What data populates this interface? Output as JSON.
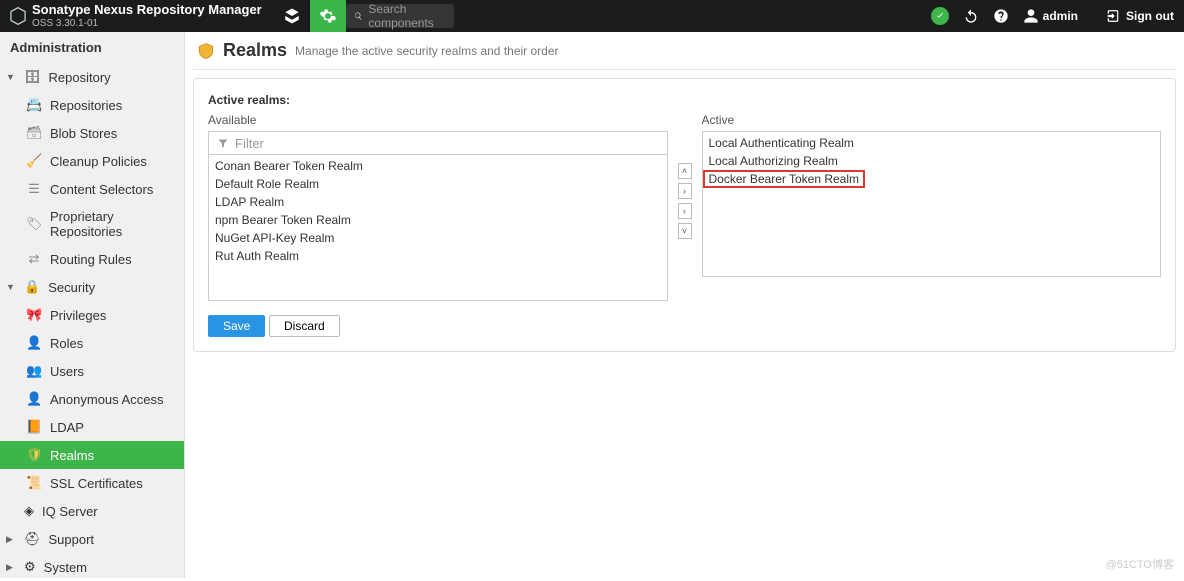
{
  "app": {
    "title": "Sonatype Nexus Repository Manager",
    "version": "OSS 3.30.1-01"
  },
  "search": {
    "placeholder": "Search components"
  },
  "header": {
    "username": "admin",
    "signout": "Sign out"
  },
  "sidebar": {
    "title": "Administration",
    "sections": [
      {
        "label": "Repository",
        "items": [
          {
            "label": "Repositories",
            "icon": "repos"
          },
          {
            "label": "Blob Stores",
            "icon": "blob"
          },
          {
            "label": "Cleanup Policies",
            "icon": "broom"
          },
          {
            "label": "Content Selectors",
            "icon": "stack"
          },
          {
            "label": "Proprietary Repositories",
            "icon": "prop"
          },
          {
            "label": "Routing Rules",
            "icon": "route"
          }
        ]
      },
      {
        "label": "Security",
        "items": [
          {
            "label": "Privileges",
            "icon": "ribbon"
          },
          {
            "label": "Roles",
            "icon": "person"
          },
          {
            "label": "Users",
            "icon": "people"
          },
          {
            "label": "Anonymous Access",
            "icon": "anon"
          },
          {
            "label": "LDAP",
            "icon": "book"
          },
          {
            "label": "Realms",
            "icon": "shield",
            "active": true
          },
          {
            "label": "SSL Certificates",
            "icon": "cert"
          }
        ]
      },
      {
        "label": "IQ Server",
        "collapsed": false,
        "noCaret": true
      },
      {
        "label": "Support",
        "collapsed": true
      },
      {
        "label": "System",
        "collapsed": true
      }
    ]
  },
  "page": {
    "title": "Realms",
    "desc": "Manage the active security realms and their order"
  },
  "realms": {
    "heading": "Active realms:",
    "available_label": "Available",
    "active_label": "Active",
    "filter_placeholder": "Filter",
    "available": [
      "Conan Bearer Token Realm",
      "Default Role Realm",
      "LDAP Realm",
      "npm Bearer Token Realm",
      "NuGet API-Key Realm",
      "Rut Auth Realm"
    ],
    "active": [
      "Local Authenticating Realm",
      "Local Authorizing Realm",
      "Docker Bearer Token Realm"
    ],
    "highlight_index": 2
  },
  "actions": {
    "save": "Save",
    "discard": "Discard"
  },
  "watermark": "@51CTO博客"
}
